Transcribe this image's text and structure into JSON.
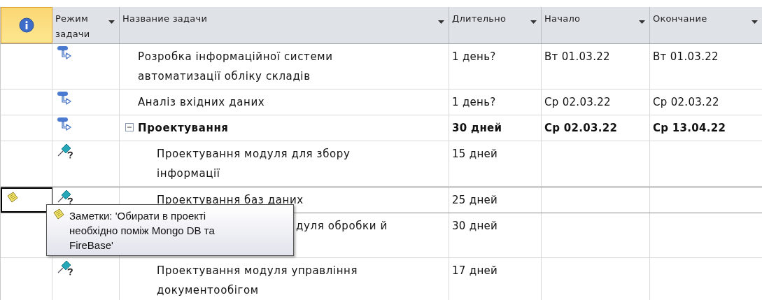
{
  "columns": [
    {
      "kind": "info"
    },
    {
      "kind": "text",
      "label": "Режим задачи"
    },
    {
      "kind": "text",
      "label": "Название задачи"
    },
    {
      "kind": "text",
      "label": "Длительно"
    },
    {
      "kind": "text",
      "label": "Начало"
    },
    {
      "kind": "text",
      "label": "Окончание"
    }
  ],
  "tasks": [
    {
      "kind": "auto",
      "name": "Розробка інформаційної системи автоматизації обліку складів",
      "duration": "1 день?",
      "start": "Вт 01.03.22",
      "finish": "Вт 01.03.22",
      "bold": false,
      "selected": false
    },
    {
      "kind": "auto",
      "name": "Аналіз вхідних даних",
      "duration": "1 день?",
      "start": "Ср 02.03.22",
      "finish": "Ср 02.03.22",
      "bold": false,
      "selected": false
    },
    {
      "kind": "auto",
      "name": "Проектування",
      "duration": "30 дней",
      "start": "Ср 02.03.22",
      "finish": "Ср 13.04.22",
      "bold": true,
      "selected": false,
      "expanded": true,
      "children": [
        {
          "kind": "manual",
          "name": "Проектування модуля для збору інформації",
          "duration": "15 дней",
          "bold": false,
          "selected": false
        },
        {
          "kind": "manual",
          "has_note": true,
          "name": "Проектування баз даних",
          "duration": "25 дней",
          "bold": false,
          "selected": true
        },
        {
          "kind": "covered",
          "name": "дуля обробки й",
          "duration": "30 дней",
          "bold": false,
          "selected": false
        },
        {
          "kind": "manual",
          "name": "Проектування модуля управління документообігом",
          "duration": "17 дней",
          "bold": false,
          "selected": false
        }
      ]
    }
  ],
  "tooltip": {
    "text": "Заметки: 'Обирати в проекті необхідно поміж Mongo DB та FireBase'"
  }
}
